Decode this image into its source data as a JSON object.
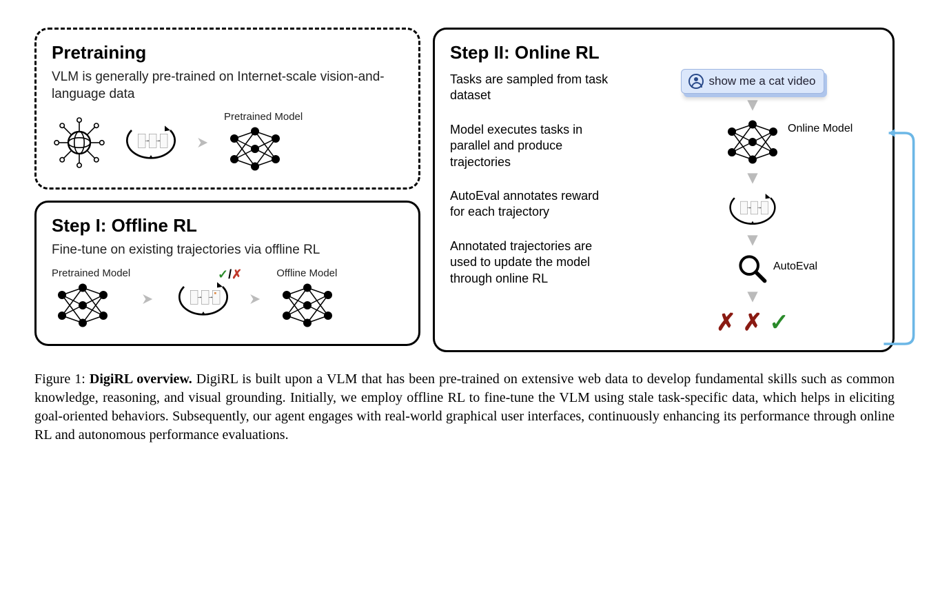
{
  "panels": {
    "pretraining": {
      "title": "Pretraining",
      "desc": "VLM is generally pre-trained on Internet-scale vision-and-language data",
      "model_label": "Pretrained Model"
    },
    "step1": {
      "title": "Step I: Offline RL",
      "desc": "Fine-tune on existing trajectories via offline RL",
      "input_label": "Pretrained Model",
      "output_label": "Offline Model",
      "reward_marks": "✓/✗"
    },
    "step2": {
      "title": "Step II: Online RL",
      "prompt_text": "show me a cat video",
      "text_items": [
        "Tasks are sampled from task dataset",
        "Model executes tasks in parallel and produce trajectories",
        "AutoEval annotates reward for each trajectory",
        "Annotated trajectories are used to update the model through online RL"
      ],
      "model_label": "Online Model",
      "autoeval_label": "AutoEval",
      "result_marks": [
        "✗",
        "✗",
        "✓"
      ]
    }
  },
  "caption": {
    "fignum": "Figure 1:",
    "figtitle": "DigiRL overview.",
    "body": "DigiRL is built upon a VLM that has been pre-trained on extensive web data to develop fundamental skills such as common knowledge, reasoning, and visual grounding. Initially, we employ offline RL to fine-tune the VLM using stale task-specific data, which helps in eliciting goal-oriented behaviors. Subsequently, our agent engages with real-world graphical user interfaces, continuously enhancing its performance through online RL and autonomous performance evaluations."
  }
}
